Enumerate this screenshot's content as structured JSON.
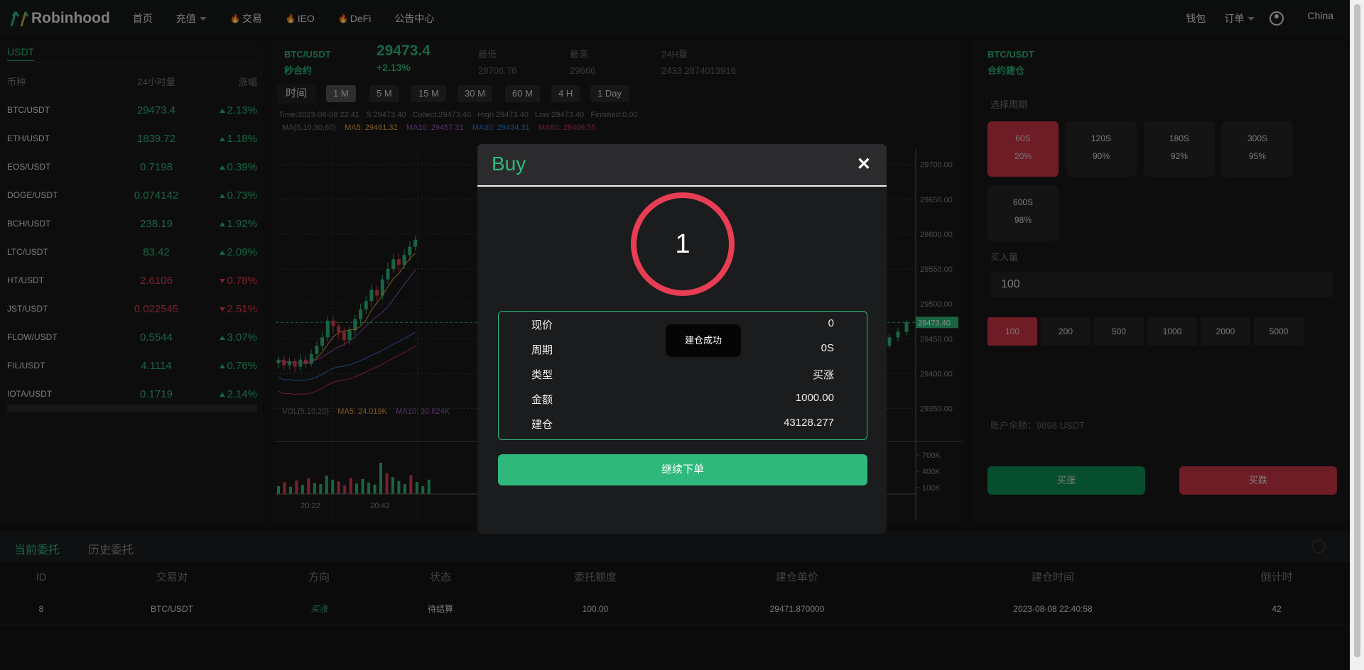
{
  "nav": {
    "brand": "Robinhood",
    "items": [
      {
        "label": "首页",
        "fire": false,
        "caret": false
      },
      {
        "label": "充值",
        "fire": false,
        "caret": true
      },
      {
        "label": "交易",
        "fire": true,
        "caret": false
      },
      {
        "label": "IEO",
        "fire": true,
        "caret": false
      },
      {
        "label": "DeFi",
        "fire": true,
        "caret": false
      },
      {
        "label": "公告中心",
        "fire": false,
        "caret": false
      }
    ],
    "wallet": "钱包",
    "orders": "订单",
    "region": "China"
  },
  "market": {
    "tab": "USDT",
    "headers": [
      "币种",
      "24小时量",
      "涨幅"
    ],
    "rows": [
      {
        "pair": "BTC/USDT",
        "price": "29473.4",
        "change": "2.13%",
        "dir": "up"
      },
      {
        "pair": "ETH/USDT",
        "price": "1839.72",
        "change": "1.18%",
        "dir": "up"
      },
      {
        "pair": "EOS/USDT",
        "price": "0.7198",
        "change": "0.39%",
        "dir": "up"
      },
      {
        "pair": "DOGE/USDT",
        "price": "0.074142",
        "change": "0.73%",
        "dir": "up"
      },
      {
        "pair": "BCH/USDT",
        "price": "238.19",
        "change": "1.92%",
        "dir": "up"
      },
      {
        "pair": "LTC/USDT",
        "price": "83.42",
        "change": "2.09%",
        "dir": "up"
      },
      {
        "pair": "HT/USDT",
        "price": "2.6106",
        "change": "0.78%",
        "dir": "down"
      },
      {
        "pair": "JST/USDT",
        "price": "0.022545",
        "change": "2.51%",
        "dir": "down"
      },
      {
        "pair": "FLOW/USDT",
        "price": "0.5544",
        "change": "3.07%",
        "dir": "up"
      },
      {
        "pair": "FIL/USDT",
        "price": "4.1114",
        "change": "0.76%",
        "dir": "up"
      },
      {
        "pair": "IOTA/USDT",
        "price": "0.1719",
        "change": "2.14%",
        "dir": "up"
      }
    ]
  },
  "ticker": {
    "pair": "BTC/USDT",
    "subtitle": "秒合约",
    "price": "29473.4",
    "change": "+2.13%",
    "low_label": "最低",
    "low": "28706.76",
    "high_label": "最高",
    "high": "29666",
    "vol_label": "24H量",
    "vol": "2433.2874013916"
  },
  "timeframes": {
    "label": "时间",
    "items": [
      "1 M",
      "5 M",
      "15 M",
      "30 M",
      "60 M",
      "4 H",
      "1 Day"
    ],
    "active": "1 M"
  },
  "chart_info": {
    "time": "Time:2023-08-08 22:41",
    "s": "S:29473.40",
    "collect": "Collect:29473.40",
    "high": "High:29473.40",
    "low": "Low:29473.40",
    "finished": "Finished:0.00",
    "ma_label": "MA(5,10,30,60)",
    "ma5": "MA5: 29461.32",
    "ma10": "MA10: 29457.31",
    "ma30": "MA30: 29434.31",
    "ma60": "MA60: 29409.55",
    "vol_label": "VOL(5,10,20)",
    "vol_ma5": "MA5: 24.019K",
    "vol_ma10": "MA10: 30.624K",
    "price_ticks": [
      "29700.00",
      "29650.00",
      "29600.00",
      "29550.00",
      "29500.00",
      "29450.00",
      "29400.00",
      "29350.00"
    ],
    "current_price_tag": "29473.40",
    "vol_ticks": [
      "700K",
      "400K",
      "100K"
    ],
    "time_ticks": [
      "20:22",
      "20:42"
    ]
  },
  "chart_data": {
    "type": "candlestick",
    "pair": "BTC/USDT",
    "ylim": [
      29320,
      29720
    ],
    "current_price": 29473.4,
    "series": [
      {
        "name": "MA5",
        "color": "#e6a23c"
      },
      {
        "name": "MA10",
        "color": "#9b59b6"
      },
      {
        "name": "MA30",
        "color": "#3a7bd5"
      },
      {
        "name": "MA60",
        "color": "#c0395a"
      }
    ],
    "candles": [
      [
        29415,
        29420,
        29408,
        29425
      ],
      [
        29420,
        29412,
        29405,
        29426
      ],
      [
        29412,
        29418,
        29406,
        29423
      ],
      [
        29418,
        29410,
        29402,
        29422
      ],
      [
        29410,
        29420,
        29405,
        29428
      ],
      [
        29420,
        29414,
        29408,
        29426
      ],
      [
        29414,
        29428,
        29410,
        29434
      ],
      [
        29428,
        29440,
        29422,
        29446
      ],
      [
        29440,
        29452,
        29434,
        29460
      ],
      [
        29452,
        29476,
        29446,
        29482
      ],
      [
        29476,
        29468,
        29458,
        29482
      ],
      [
        29468,
        29460,
        29450,
        29474
      ],
      [
        29460,
        29448,
        29440,
        29466
      ],
      [
        29448,
        29462,
        29442,
        29468
      ],
      [
        29462,
        29478,
        29455,
        29484
      ],
      [
        29478,
        29492,
        29470,
        29500
      ],
      [
        29492,
        29504,
        29486,
        29512
      ],
      [
        29504,
        29520,
        29496,
        29528
      ],
      [
        29520,
        29512,
        29500,
        29526
      ],
      [
        29512,
        29535,
        29506,
        29542
      ],
      [
        29535,
        29550,
        29528,
        29560
      ],
      [
        29550,
        29564,
        29544,
        29572
      ],
      [
        29564,
        29556,
        29546,
        29572
      ],
      [
        29556,
        29570,
        29550,
        29578
      ],
      [
        29570,
        29582,
        29562,
        29590
      ],
      [
        29582,
        29592,
        29576,
        29598
      ]
    ],
    "tail_candles": [
      [
        29448,
        29440,
        29432,
        29454
      ],
      [
        29440,
        29452,
        29436,
        29458
      ],
      [
        29452,
        29460,
        29446,
        29466
      ],
      [
        29460,
        29473.4,
        29455,
        29478
      ]
    ],
    "volumes": [
      30,
      45,
      28,
      52,
      35,
      60,
      42,
      38,
      70,
      55,
      48,
      33,
      62,
      40,
      58,
      44,
      36,
      120,
      80,
      65,
      50,
      38,
      72,
      46,
      30,
      55
    ]
  },
  "trade": {
    "pair": "BTC/USDT",
    "subtitle": "合约建仓",
    "period_label": "选择周期",
    "periods": [
      {
        "time": "60S",
        "rate": "20%",
        "active": true
      },
      {
        "time": "120S",
        "rate": "90%",
        "active": false
      },
      {
        "time": "180S",
        "rate": "92%",
        "active": false
      },
      {
        "time": "300S",
        "rate": "95%",
        "active": false
      },
      {
        "time": "600S",
        "rate": "98%",
        "active": false
      }
    ],
    "amount_label": "买入量",
    "amount_value": "100",
    "quick_amounts": [
      "100",
      "200",
      "500",
      "1000",
      "2000",
      "5000"
    ],
    "balance": "账户余额：9898 USDT",
    "buy_label": "买涨",
    "sell_label": "买跌"
  },
  "orders": {
    "tab_current": "当前委托",
    "tab_history": "历史委托",
    "headers": [
      "ID",
      "交易对",
      "方向",
      "状态",
      "委托额度",
      "建仓单价",
      "建仓时间",
      "倒计时"
    ],
    "row": {
      "id": "8",
      "pair": "BTC/USDT",
      "direction": "买涨",
      "status": "待结算",
      "amount": "100.00",
      "price": "29471.870000",
      "time": "2023-08-08 22:40:58",
      "countdown": "42"
    }
  },
  "modal": {
    "title": "Buy",
    "countdown": "1",
    "rows": [
      {
        "k": "现价",
        "v": "0"
      },
      {
        "k": "周期",
        "v": "0S"
      },
      {
        "k": "类型",
        "v": "买涨"
      },
      {
        "k": "金额",
        "v": "1000.00"
      },
      {
        "k": "建仓",
        "v": "43128.277"
      }
    ],
    "toast": "建仓成功",
    "continue_label": "继续下单"
  },
  "colors": {
    "green": "#2eb87b",
    "red": "#e03d4f",
    "dark_red": "#c93446"
  }
}
